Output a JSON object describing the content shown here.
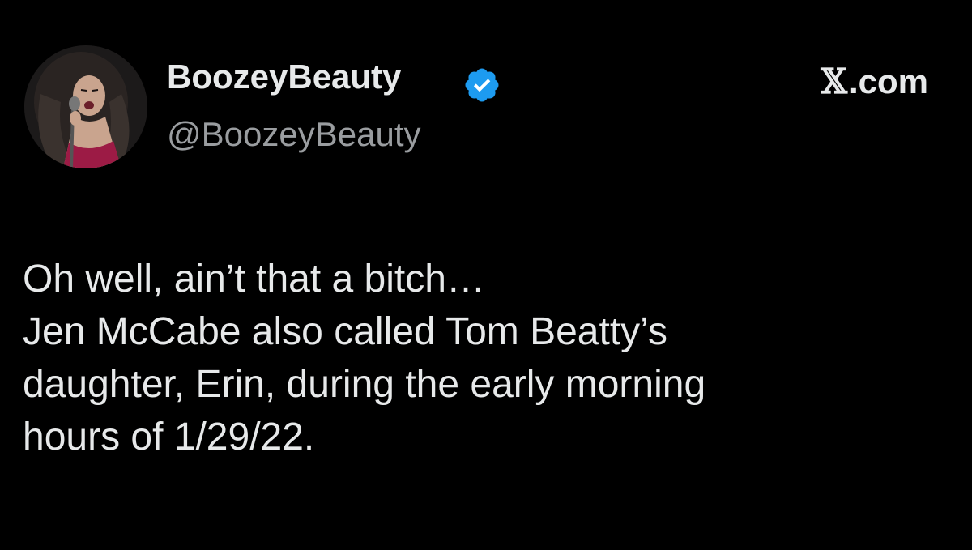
{
  "author": {
    "display_name": "BoozeyBeauty",
    "handle": "@BoozeyBeauty",
    "verified_badge_color": "#1d9bf0"
  },
  "site": {
    "logo_glyph": "𝕏",
    "suffix": ".com"
  },
  "tweet": {
    "lines": [
      "Oh well, ain’t that a bitch…",
      "Jen McCabe also called Tom Beatty’s",
      "daughter, Erin, during the early morning",
      "hours of 1/29/22."
    ]
  },
  "colors": {
    "background": "#000000",
    "text": "#e7e9ea",
    "muted": "#9a9da0"
  }
}
